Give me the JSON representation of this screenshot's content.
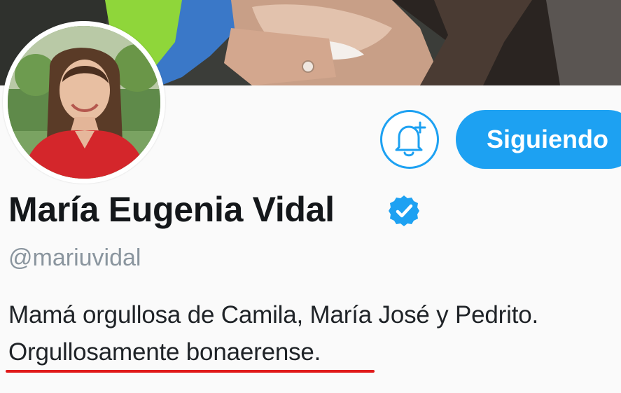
{
  "profile": {
    "follow_button_label": "Siguiendo",
    "display_name": "María Eugenia Vidal",
    "handle": "@mariuvidal",
    "bio_line_1": "Mamá orgullosa de Camila, María José y Pedrito.",
    "bio_line_2": "Orgullosamente bonaerense."
  },
  "icons": {
    "bell": "bell-plus-icon",
    "verified": "verified-badge-icon"
  },
  "colors": {
    "accent": "#1da1f2",
    "annotation_underline": "#e01a1a",
    "name_text": "#14171a",
    "handle_text": "#8a959e"
  }
}
